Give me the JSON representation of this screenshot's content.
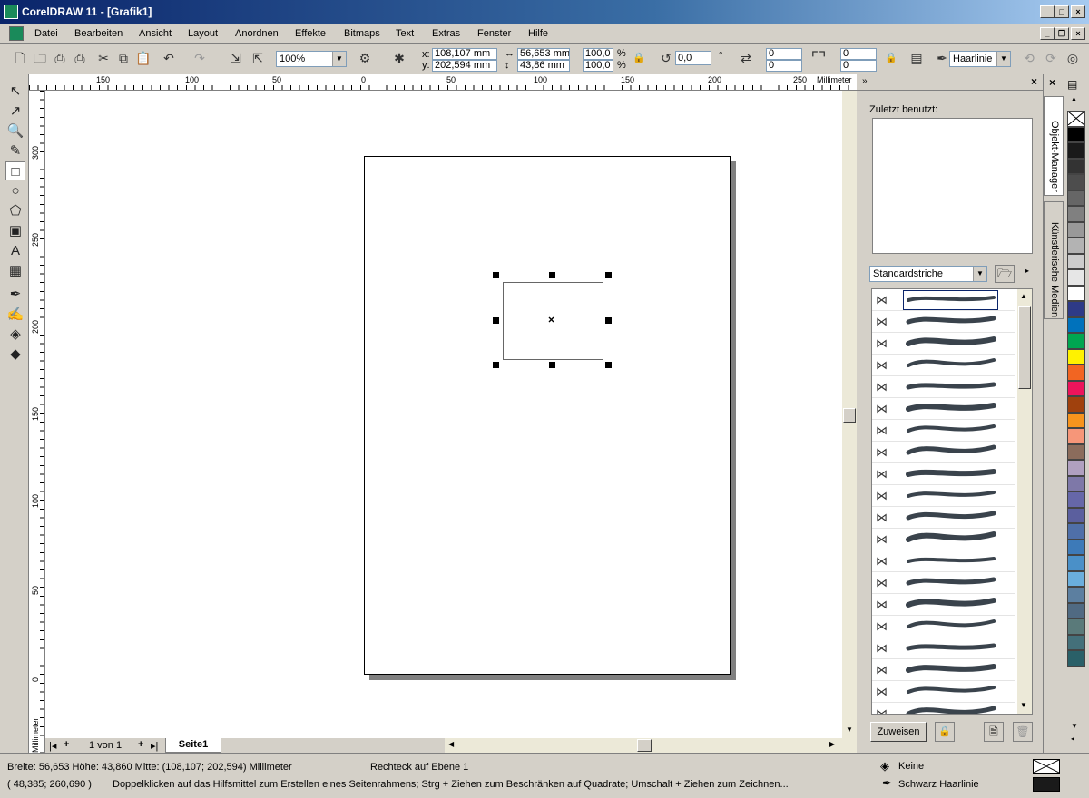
{
  "app": {
    "title": "CorelDRAW 11 - [Grafik1]"
  },
  "menu": [
    "Datei",
    "Bearbeiten",
    "Ansicht",
    "Layout",
    "Anordnen",
    "Effekte",
    "Bitmaps",
    "Text",
    "Extras",
    "Fenster",
    "Hilfe"
  ],
  "toolbar": {
    "zoom": "100%",
    "x_label": "x:",
    "x_value": "108,107 mm",
    "y_label": "y:",
    "y_value": "202,594 mm",
    "w_value": "56,653 mm",
    "h_value": "43,86 mm",
    "scale_x": "100,0",
    "scale_y": "100,0",
    "pct": "%",
    "rotation": "0,0",
    "deg": "°",
    "corner_1": "0",
    "corner_2": "0",
    "corner_3": "0",
    "corner_4": "0",
    "outline_width": "Haarlinie"
  },
  "ruler": {
    "unit": "Millimeter",
    "h_ticks": [
      "150",
      "100",
      "50",
      "0",
      "50",
      "100",
      "150",
      "200",
      "250"
    ],
    "v_ticks": [
      "300",
      "250",
      "200",
      "150",
      "100",
      "50",
      "0"
    ]
  },
  "pages": {
    "nav": "1 von 1",
    "tab": "Seite1"
  },
  "docker": {
    "recent_label": "Zuletzt benutzt:",
    "category": "Standardstriche",
    "apply_button": "Zuweisen",
    "tab_object_manager": "Objekt-Manager",
    "tab_artistic_media": "Künstlerische Medien",
    "stroke_count": 20
  },
  "palette": [
    "#ffffff",
    "#000000",
    "#1a1a1a",
    "#333333",
    "#4d4d4d",
    "#666666",
    "#808080",
    "#999999",
    "#b3b3b3",
    "#cccccc",
    "#e6e6e6",
    "#ffffff",
    "#2e3a87",
    "#0072bc",
    "#00a651",
    "#fff200",
    "#f26522",
    "#ed145b",
    "#a0410d",
    "#f7941d",
    "#f69679",
    "#8b6c5c",
    "#b0a0c0",
    "#7e78a8",
    "#6667a8",
    "#5b5f9e",
    "#4f6fa8",
    "#3d7ab8",
    "#4a90c8",
    "#6aaedc",
    "#5c7fa0",
    "#506a82",
    "#5a7a7a",
    "#44707a",
    "#2a6068"
  ],
  "status": {
    "size_info": "Breite: 56,653  Höhe: 43,860  Mitte: (108,107; 202,594)  Millimeter",
    "object_info": "Rechteck auf Ebene 1",
    "coords": "( 48,385; 260,690 )",
    "hint": "Doppelklicken auf das Hilfsmittel zum Erstellen eines Seitenrahmens; Strg + Ziehen zum Beschränken auf Quadrate; Umschalt + Ziehen zum Zeichnen...",
    "fill": "Keine",
    "outline": "Schwarz  Haarlinie"
  }
}
